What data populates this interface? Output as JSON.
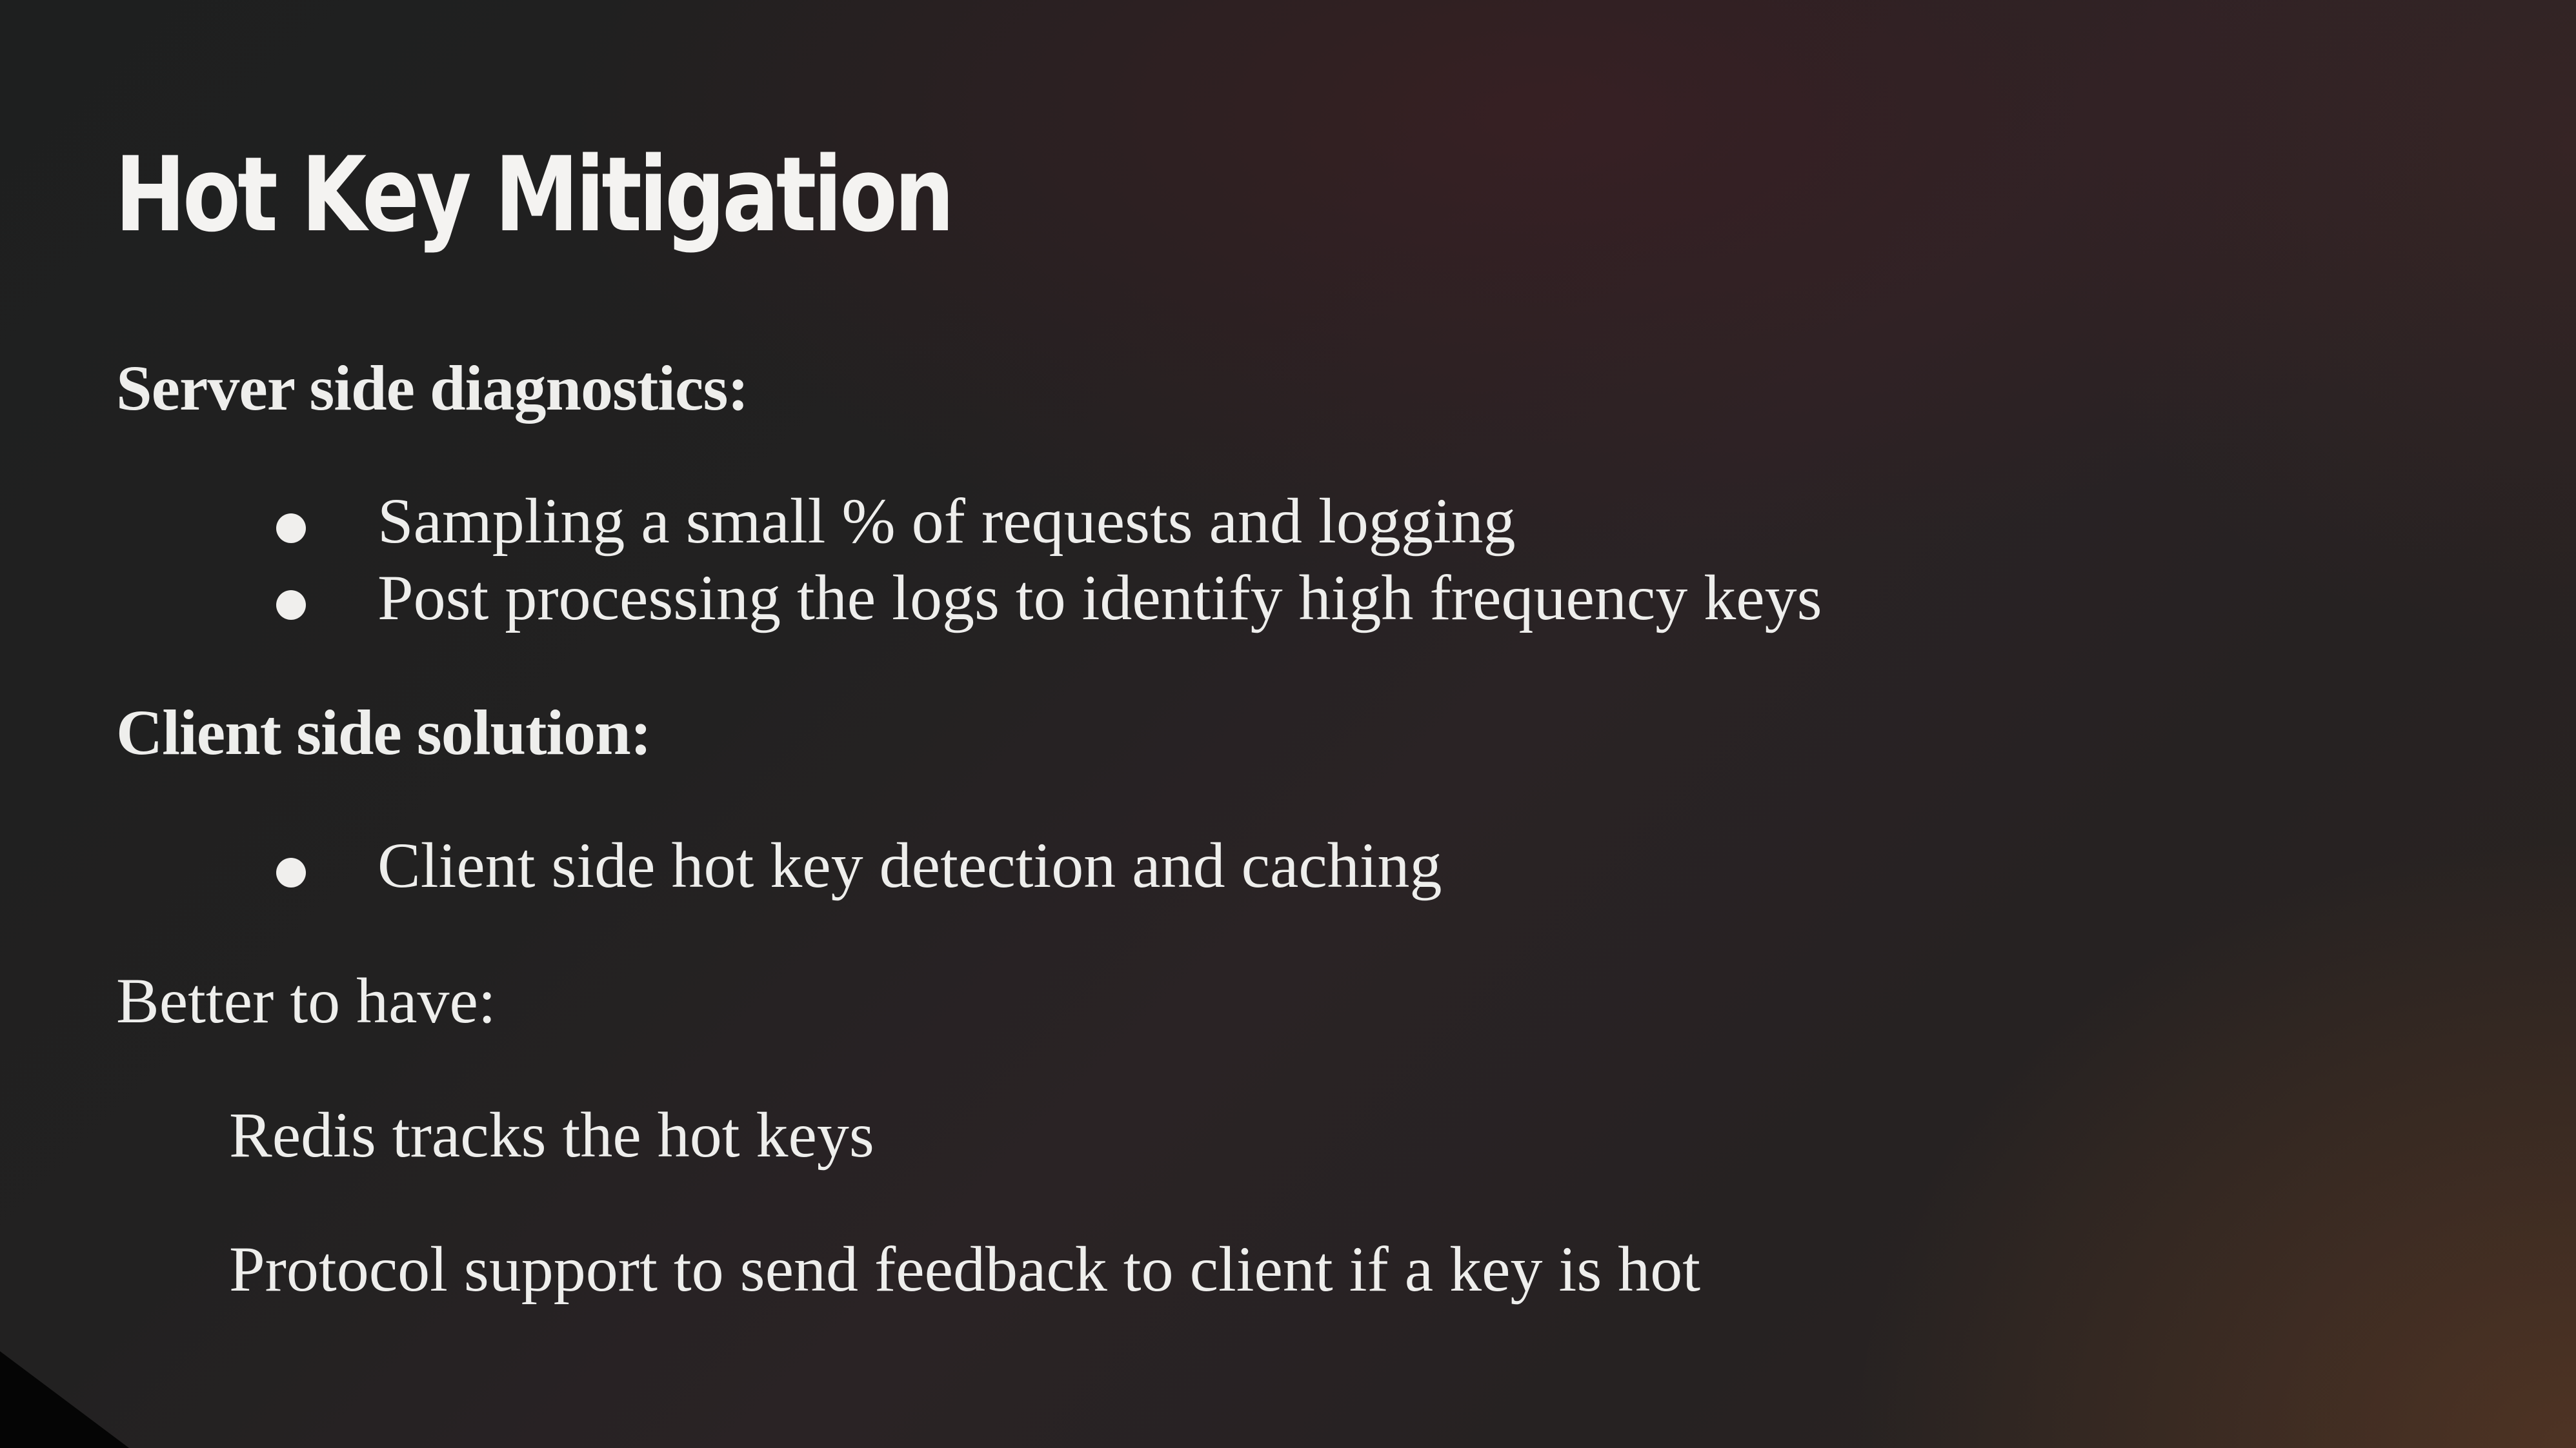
{
  "slide": {
    "title": "Hot Key Mitigation",
    "sections": [
      {
        "heading": "Server side diagnostics:",
        "bullets": [
          "Sampling a small % of requests and logging",
          "Post processing the logs to identify high frequency keys"
        ]
      },
      {
        "heading": "Client side solution:",
        "bullets": [
          "Client side hot key detection and caching"
        ]
      },
      {
        "heading": "Better to have:",
        "items": [
          "Redis tracks the hot keys",
          "Protocol support to send feedback to client if a key is hot"
        ]
      }
    ]
  },
  "colors": {
    "background": "#1f1f1f",
    "text": "#eeeeec"
  }
}
